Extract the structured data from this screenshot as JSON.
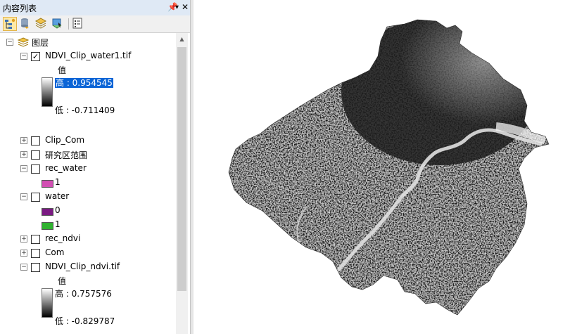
{
  "toc": {
    "title": "内容列表",
    "pin_glyph": "ᚹ",
    "close_glyph": "✕",
    "toolbar_icons": [
      "list-by-drawing-order-icon",
      "list-by-source-icon",
      "list-by-visibility-icon",
      "list-by-selection-icon",
      "options-icon"
    ],
    "root": {
      "label": "图层"
    },
    "layers": [
      {
        "name": "NDVI_Clip_water1.tif",
        "checked": true,
        "expanded": true,
        "legend": {
          "heading": "值",
          "high": "高 : 0.954545",
          "low": "低 : -0.711409"
        }
      },
      {
        "name": "Clip_Com",
        "checked": false,
        "expanded": false
      },
      {
        "name": "研究区范围",
        "checked": false,
        "expanded": false
      },
      {
        "name": "rec_water",
        "checked": false,
        "expanded": true,
        "classes": [
          {
            "label": "1",
            "color": "#d24fb3"
          }
        ]
      },
      {
        "name": "water",
        "checked": false,
        "expanded": true,
        "classes": [
          {
            "label": "0",
            "color": "#7a1a82"
          },
          {
            "label": "1",
            "color": "#2fb22f"
          }
        ]
      },
      {
        "name": "rec_ndvi",
        "checked": false,
        "expanded": false
      },
      {
        "name": "Com",
        "checked": false,
        "expanded": false
      },
      {
        "name": "NDVI_Clip_ndvi.tif",
        "checked": false,
        "expanded": true,
        "legend": {
          "heading": "值",
          "high": "高 : 0.757576",
          "low": "低 : -0.829787"
        }
      }
    ],
    "colors": {
      "selection": "#0a64d6",
      "title_bar": "#dfe9f5"
    }
  },
  "map": {
    "layer": "NDVI raster (grayscale)"
  }
}
